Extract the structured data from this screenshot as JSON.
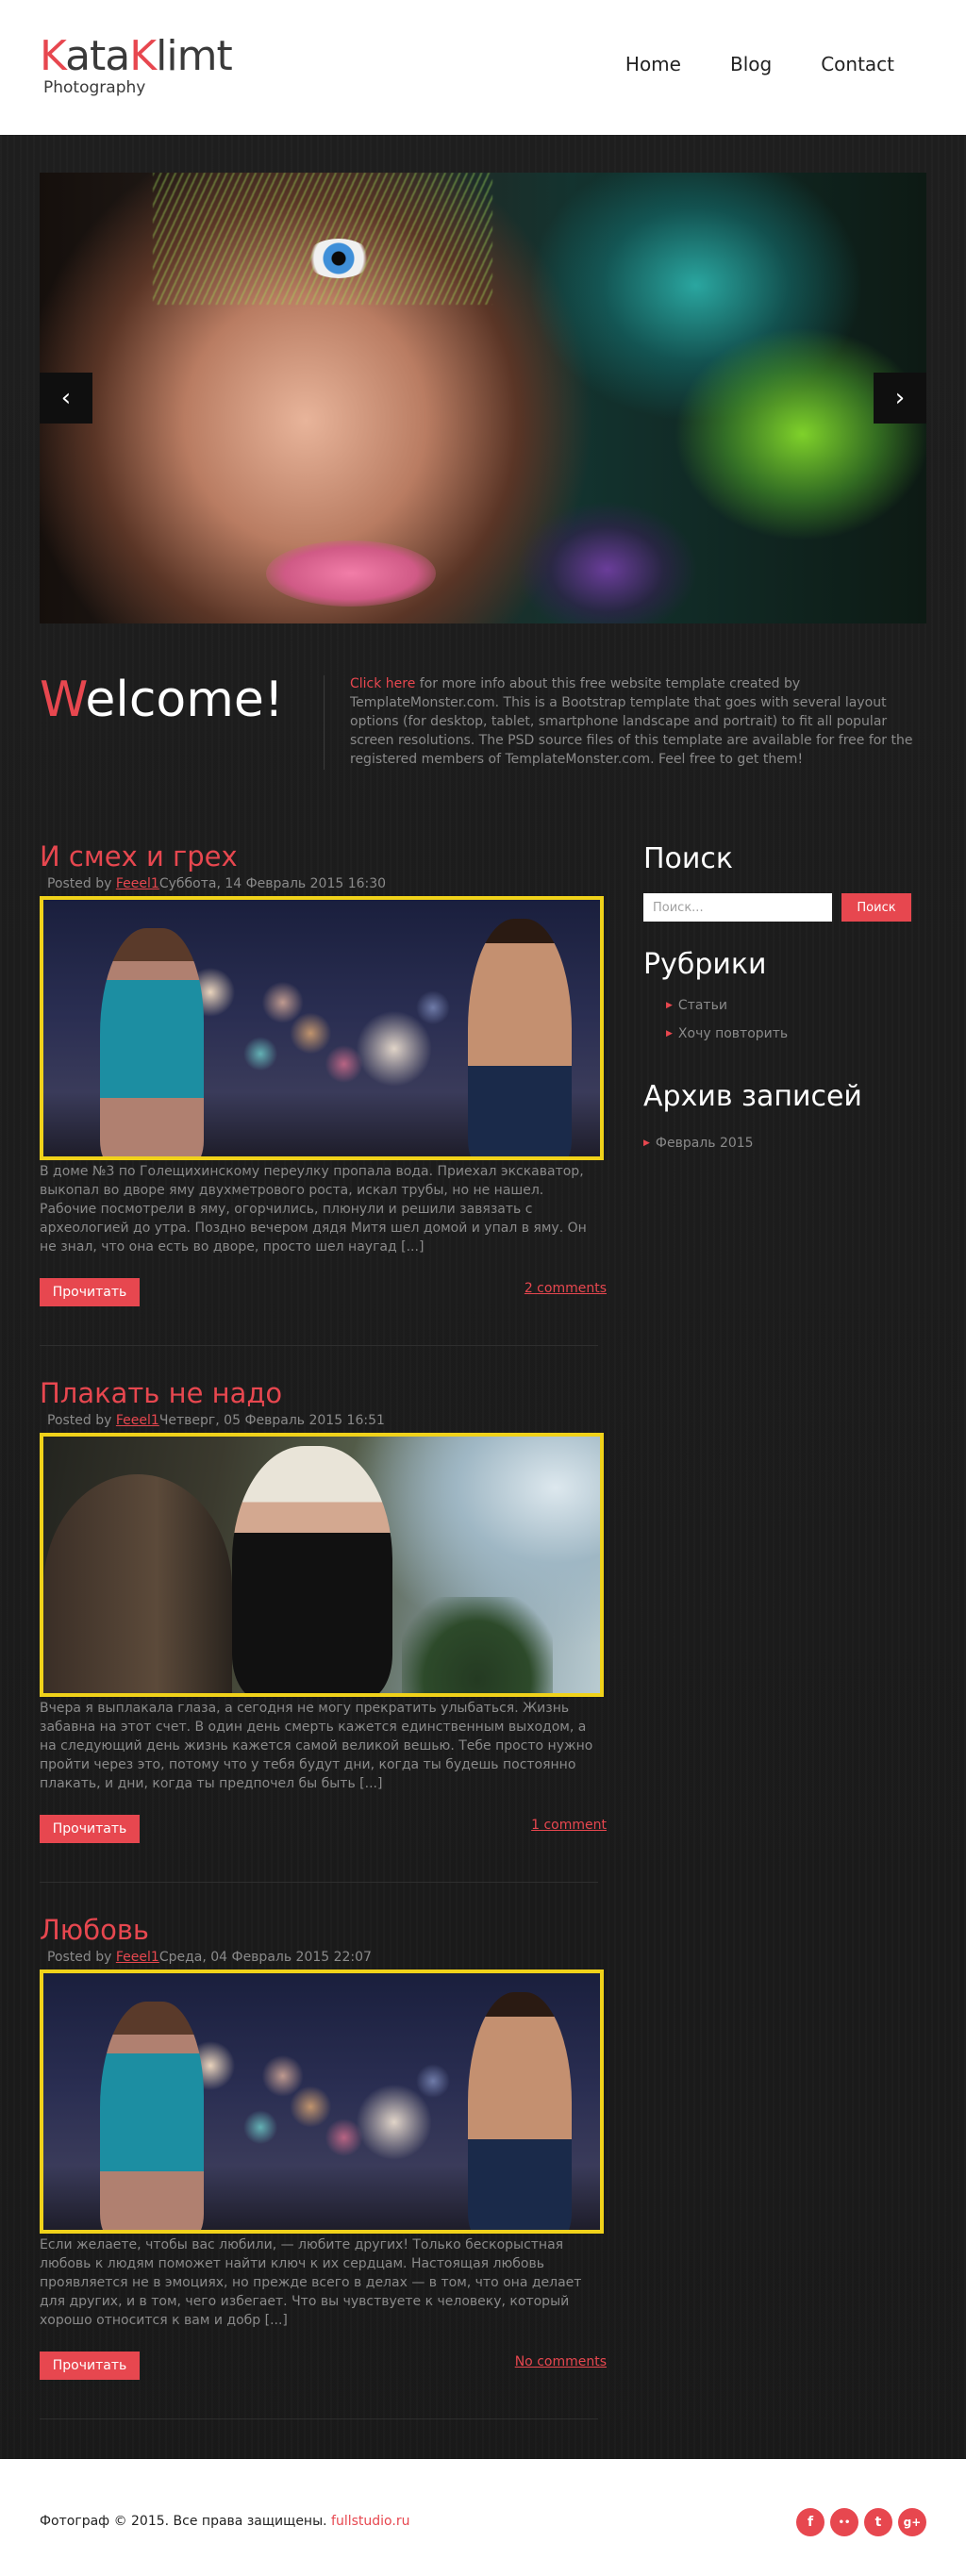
{
  "header": {
    "logo_part1": "Kata",
    "logo_part2": "K",
    "logo_part3": "limt",
    "logo_sub": "Photography",
    "nav": [
      "Home",
      "Blog",
      "Contact"
    ]
  },
  "slider": {
    "prev_icon": "chevron-left-icon",
    "next_icon": "chevron-right-icon",
    "prev_glyph": "‹",
    "next_glyph": "›"
  },
  "welcome": {
    "title_first": "W",
    "title_rest": "elcome!",
    "link": "Click here",
    "text": " for more info about this free website template created by TemplateMonster.com. This is a Bootstrap template that goes with several layout options (for desktop, tablet, smartphone landscape and portrait) to fit all popular screen resolutions. The PSD source files of this template are available for free for the registered members of TemplateMonster.com. Feel free to get them!"
  },
  "posts": [
    {
      "title": "И смех и грех",
      "posted_by": "Posted by ",
      "author": "Feeel1",
      "date": "Суббота, 14 Февраль 2015 16:30",
      "excerpt": "В доме №3 по Голещихинскому переулку пропала вода. Приехал экскаватор, выкопал во дворе яму двухметрового роста, искал трубы, но не нашел. Рабочие посмотрели в яму, огорчились, плюнули и решили завязать с археологией до утра. Поздно вечером дядя Митя шел домой и упал в яму. Он не знал, что она есть во дворе, просто шел наугад [...]",
      "read_label": "Прочитать",
      "comments": "2 comments"
    },
    {
      "title": "Плакать не надо",
      "posted_by": "Posted by ",
      "author": "Feeel1",
      "date": "Четверг, 05 Февраль 2015 16:51",
      "excerpt": "Вчера я выплакала глаза, а сегодня не могу прекратить улыбаться. Жизнь забавна на этот счет. В один день смерть кажется единственным выходом, а на следующий день жизнь кажется самой великой вешью. Тебе просто нужно пройти через это, потому что у тебя будут дни, когда ты будешь постоянно плакать, и дни, когда ты предпочел бы быть [...]",
      "read_label": "Прочитать",
      "comments": "1 comment"
    },
    {
      "title": "Любовь",
      "posted_by": "Posted by ",
      "author": "Feeel1",
      "date": "Среда, 04 Февраль 2015 22:07",
      "excerpt": "Если желаете, чтобы вас любили, — любите других! Только бескорыстная любовь к людям поможет найти ключ к их сердцам. Настоящая любовь проявляется не в эмоциях, но прежде всего в делах — в том, что она делает для других, и в том, чего избегает. Что вы чувствуете к человеку, который хорошо относится к вам и добр [...]",
      "read_label": "Прочитать",
      "comments": "No comments"
    }
  ],
  "sidebar": {
    "search_title": "Поиск",
    "search_placeholder": "Поиск...",
    "search_button": "Поиск",
    "categories_title": "Рубрики",
    "categories": [
      "Статьи",
      "Хочу повторить"
    ],
    "archive_title": "Архив записей",
    "archive": [
      "Февраль 2015"
    ]
  },
  "footer": {
    "copyright": "Фотограф © 2015. Все права защищены. ",
    "site_link": "fullstudio.ru",
    "socials": [
      {
        "name": "facebook-icon",
        "glyph": "f"
      },
      {
        "name": "flickr-icon",
        "glyph": "••"
      },
      {
        "name": "twitter-icon",
        "glyph": "t"
      },
      {
        "name": "google-plus-icon",
        "glyph": "g+"
      }
    ]
  },
  "colors": {
    "accent": "#e7474f",
    "image_border": "#f0d21a",
    "background": "#1c1c1c"
  }
}
